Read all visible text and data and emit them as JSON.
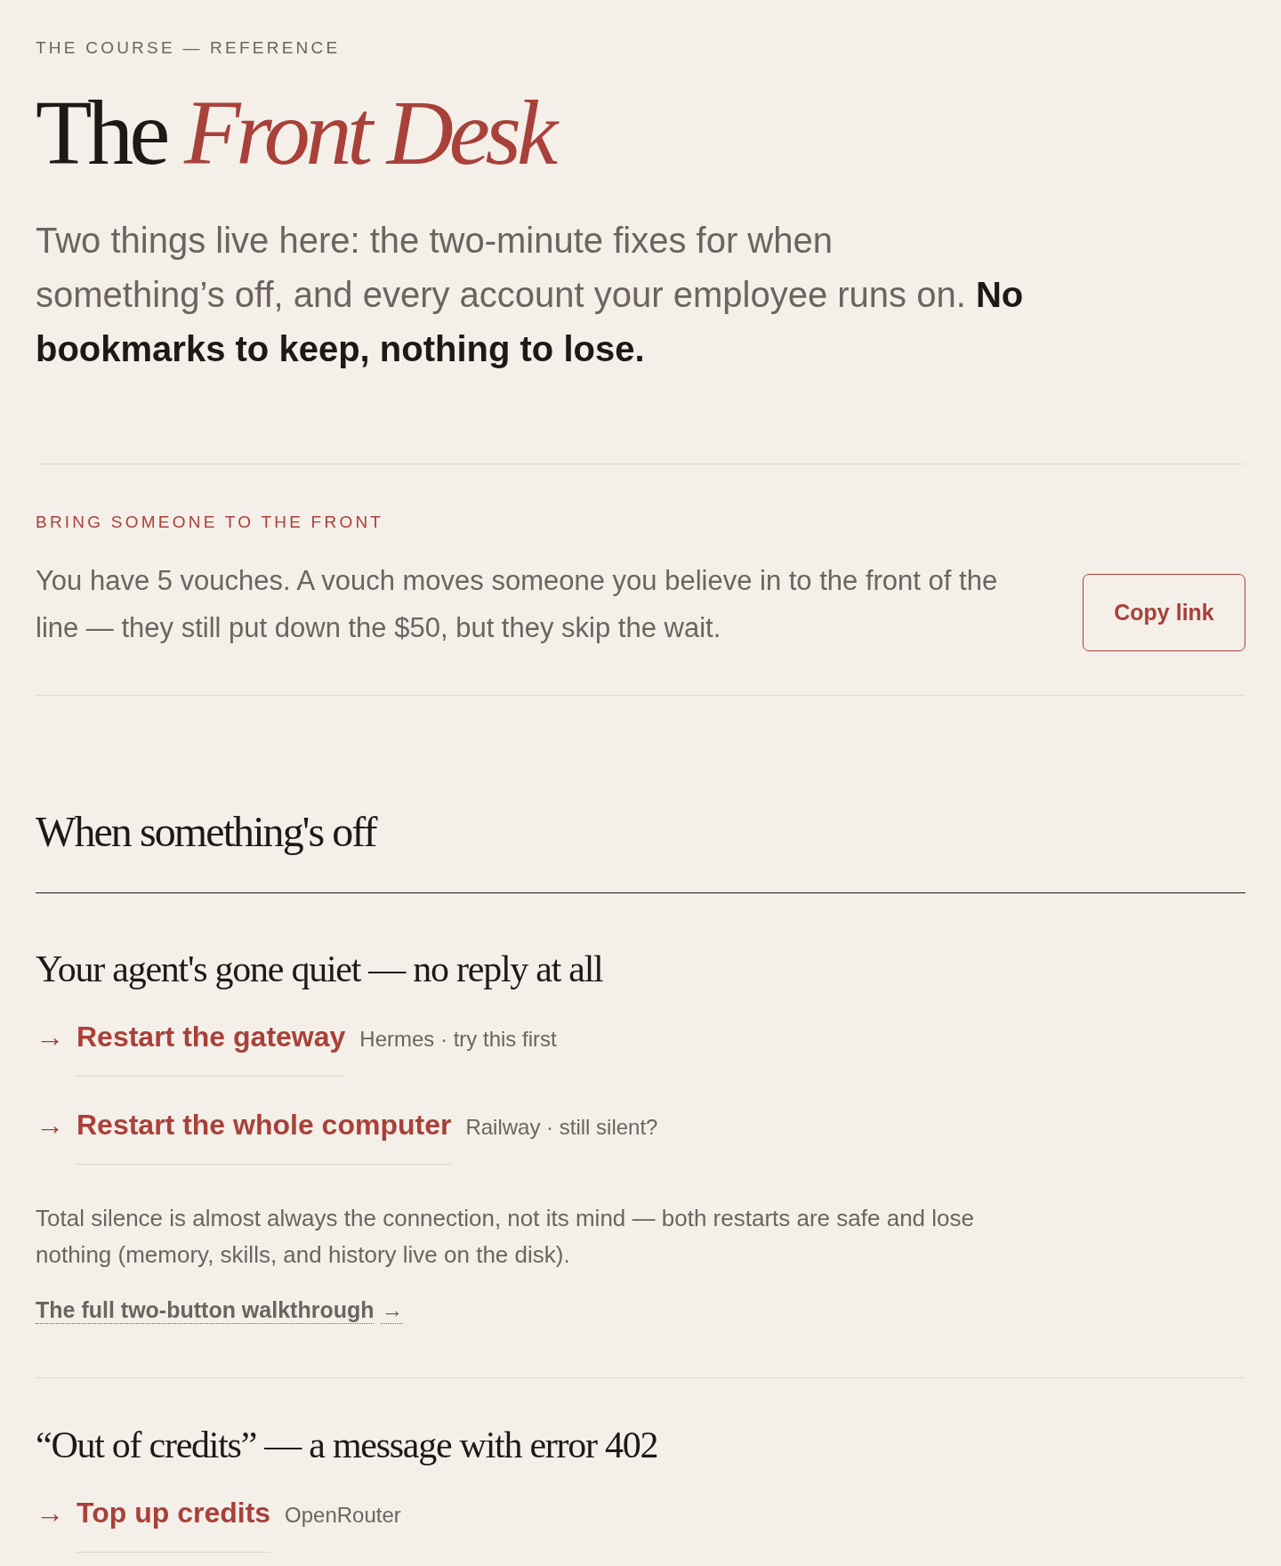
{
  "eyebrow": "THE COURSE — REFERENCE",
  "title": {
    "text": "The",
    "accent": "Front Desk"
  },
  "lead": "Two things live here: the two-minute fixes for when something’s off, and every account your employee runs on. **No bookmarks to keep, nothing to lose.**",
  "vouch": {
    "label": "BRING SOMEONE TO THE FRONT",
    "text": "You have 5 vouches. A vouch moves someone you believe in to the front of the line — they still put down the $50, but they skip the wait.",
    "button": "Copy link"
  },
  "section": {
    "title": "When something's off",
    "issues": [
      {
        "title": "Your agent's gone quiet — no reply at all",
        "actions": [
          {
            "arrow": "→",
            "label": "Restart the gateway",
            "meta": "Hermes · try this first"
          },
          {
            "arrow": "→",
            "label": "Restart the whole computer",
            "meta": "Railway · still silent?"
          }
        ],
        "note": "Total silence is almost always the connection, not its mind — both restarts are safe and lose nothing (memory, skills, and history live on the disk).",
        "more_link": {
          "label": "The full two-button walkthrough",
          "arrow": "→"
        }
      },
      {
        "title": "“Out of credits” — a message with error 402",
        "actions": [
          {
            "arrow": "→",
            "label": "Top up credits",
            "meta": "OpenRouter"
          }
        ]
      }
    ]
  }
}
